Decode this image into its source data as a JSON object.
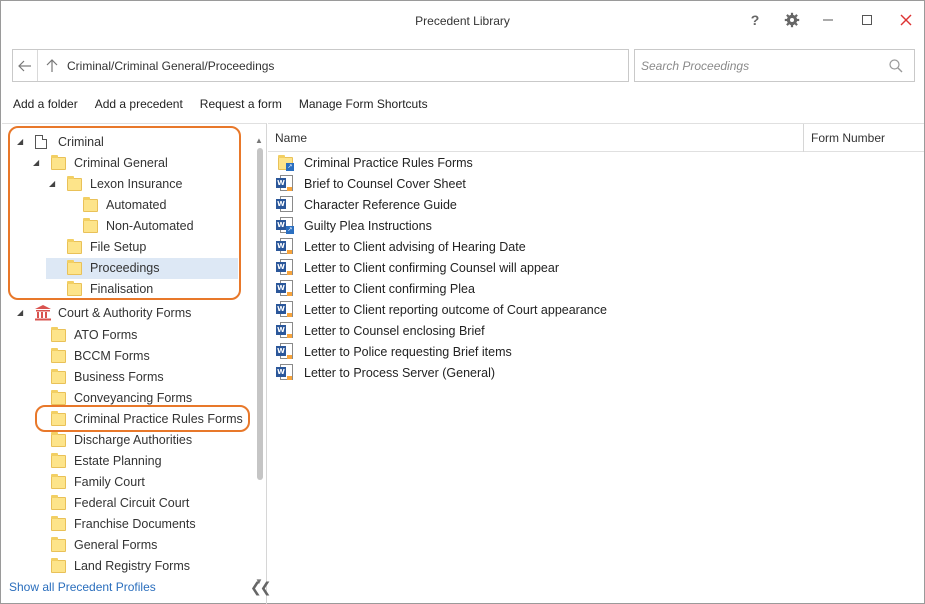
{
  "window": {
    "title": "Precedent Library",
    "help_glyph": "?",
    "gear_glyph": "⚙",
    "min_glyph": "—",
    "max_glyph": "☐",
    "close_glyph": "✕"
  },
  "address": {
    "path": "Criminal/Criminal General/Proceedings"
  },
  "search": {
    "placeholder": "Search Proceedings"
  },
  "toolbar": {
    "add_folder": "Add a folder",
    "add_precedent": "Add a precedent",
    "request_form": "Request a form",
    "manage_shortcuts": "Manage Form Shortcuts"
  },
  "tree": {
    "criminal": "Criminal",
    "criminal_general": "Criminal General",
    "lexon_insurance": "Lexon Insurance",
    "automated": "Automated",
    "non_automated": "Non-Automated",
    "file_setup": "File Setup",
    "proceedings": "Proceedings",
    "finalisation": "Finalisation",
    "court_authority": "Court & Authority Forms",
    "items": [
      "ATO Forms",
      "BCCM Forms",
      "Business Forms",
      "Conveyancing Forms",
      "Criminal Practice Rules Forms",
      "Discharge Authorities",
      "Estate Planning",
      "Family Court",
      "Federal Circuit Court",
      "Franchise Documents",
      "General Forms",
      "Land Registry Forms"
    ],
    "expanded_glyph": "◢",
    "show_all": "Show all Precedent Profiles",
    "collapse_glyph": "❮❮"
  },
  "list": {
    "col_name": "Name",
    "col_form_number": "Form Number",
    "rows": [
      "Criminal Practice Rules Forms",
      "Brief to Counsel Cover Sheet",
      "Character Reference Guide",
      "Guilty Plea Instructions",
      "Letter to Client advising of Hearing Date",
      "Letter to Client confirming Counsel will appear",
      "Letter to Client confirming Plea",
      "Letter to Client reporting outcome of Court appearance",
      "Letter to Counsel enclosing Brief",
      "Letter to Police requesting Brief items",
      "Letter to Process Server (General)"
    ]
  },
  "colors": {
    "highlight": "#e8782a",
    "selected_row": "#dde8f5",
    "link": "#2a6ebd",
    "word_blue": "#2b579a"
  }
}
